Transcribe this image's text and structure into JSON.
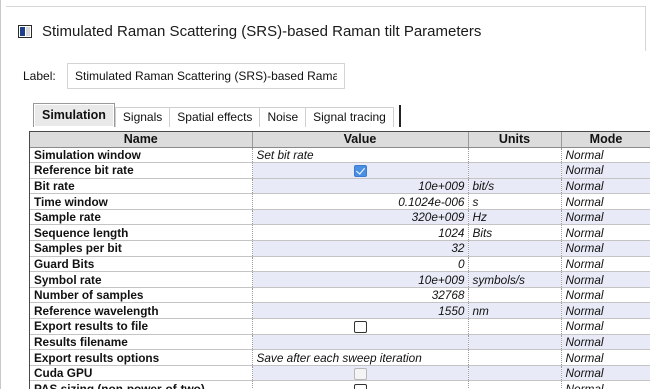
{
  "window": {
    "title": "Stimulated Raman Scattering (SRS)-based Raman tilt Parameters"
  },
  "label": {
    "caption": "Label:",
    "value": "Stimulated Raman Scattering (SRS)-based Raman tilt"
  },
  "tabs": [
    {
      "label": "Simulation",
      "active": true
    },
    {
      "label": "Signals",
      "active": false
    },
    {
      "label": "Spatial effects",
      "active": false
    },
    {
      "label": "Noise",
      "active": false
    },
    {
      "label": "Signal tracing",
      "active": false
    }
  ],
  "grid": {
    "headers": {
      "name": "Name",
      "value": "Value",
      "units": "Units",
      "mode": "Mode"
    },
    "rows": [
      {
        "name": "Simulation window",
        "value": "Set bit rate",
        "units": "",
        "mode": "Normal",
        "value_kind": "text-left",
        "value_gray": false,
        "mode_gray": false,
        "bg": "white"
      },
      {
        "name": "Reference bit rate",
        "value": "",
        "units": "",
        "mode": "Normal",
        "value_kind": "checkbox-checked",
        "value_gray": false,
        "mode_gray": true,
        "bg": "blue"
      },
      {
        "name": "Bit rate",
        "value": "10e+009",
        "units": "bit/s",
        "mode": "Normal",
        "value_kind": "text",
        "value_gray": false,
        "mode_gray": false,
        "bg": "blue"
      },
      {
        "name": "Time window",
        "value": "0.1024e-006",
        "units": "s",
        "mode": "Normal",
        "value_kind": "text",
        "value_gray": true,
        "mode_gray": true,
        "bg": "white"
      },
      {
        "name": "Sample rate",
        "value": "320e+009",
        "units": "Hz",
        "mode": "Normal",
        "value_kind": "text",
        "value_gray": true,
        "mode_gray": true,
        "bg": "blue"
      },
      {
        "name": "Sequence length",
        "value": "1024",
        "units": "Bits",
        "mode": "Normal",
        "value_kind": "text",
        "value_gray": false,
        "mode_gray": false,
        "bg": "white"
      },
      {
        "name": "Samples per bit",
        "value": "32",
        "units": "",
        "mode": "Normal",
        "value_kind": "text",
        "value_gray": false,
        "mode_gray": false,
        "bg": "blue"
      },
      {
        "name": "Guard Bits",
        "value": "0",
        "units": "",
        "mode": "Normal",
        "value_kind": "text",
        "value_gray": false,
        "mode_gray": false,
        "bg": "white"
      },
      {
        "name": "Symbol rate",
        "value": "10e+009",
        "units": "symbols/s",
        "mode": "Normal",
        "value_kind": "text",
        "value_gray": false,
        "mode_gray": false,
        "bg": "blue"
      },
      {
        "name": "Number of samples",
        "value": "32768",
        "units": "",
        "mode": "Normal",
        "value_kind": "text",
        "value_gray": false,
        "mode_gray": false,
        "bg": "white"
      },
      {
        "name": "Reference wavelength",
        "value": "1550",
        "units": "nm",
        "mode": "Normal",
        "value_kind": "text",
        "value_gray": false,
        "mode_gray": false,
        "bg": "blue"
      },
      {
        "name": "Export results to file",
        "value": "",
        "units": "",
        "mode": "Normal",
        "value_kind": "checkbox",
        "value_gray": false,
        "mode_gray": false,
        "bg": "white"
      },
      {
        "name": "Results filename",
        "value": "",
        "units": "",
        "mode": "Normal",
        "value_kind": "text",
        "value_gray": false,
        "mode_gray": true,
        "bg": "blue"
      },
      {
        "name": "Export results options",
        "value": "Save after each sweep iteration",
        "units": "",
        "mode": "Normal",
        "value_kind": "text-left",
        "value_gray": true,
        "mode_gray": true,
        "bg": "white"
      },
      {
        "name": "Cuda GPU",
        "value": "",
        "units": "",
        "mode": "Normal",
        "value_kind": "checkbox-disabled",
        "value_gray": false,
        "mode_gray": true,
        "bg": "blue"
      },
      {
        "name": "PAS sizing (non-power-of-two)",
        "value": "",
        "units": "",
        "mode": "Normal",
        "value_kind": "checkbox",
        "value_gray": false,
        "mode_gray": false,
        "bg": "white"
      }
    ]
  }
}
